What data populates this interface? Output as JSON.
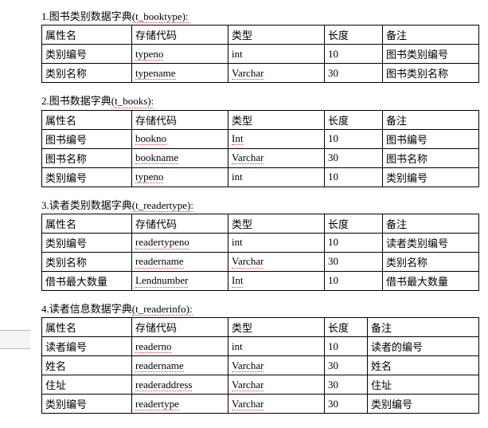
{
  "headers": [
    "属性名",
    "存储代码",
    "类型",
    "长度",
    "备注"
  ],
  "sections": [
    {
      "num": "1.",
      "title_plain": "图书类别数据字典",
      "title_spell": "(t_booktype):",
      "rows": [
        {
          "c0": "类别编号",
          "c1": "typeno",
          "c1sp": true,
          "c2": "int",
          "c2sp": false,
          "c3": "10",
          "c4": "图书类别编号"
        },
        {
          "c0": "类别名称",
          "c1": "typename",
          "c1sp": true,
          "c2": "Varchar",
          "c2sp": true,
          "c3": "30",
          "c4": "图书类别名称"
        }
      ]
    },
    {
      "num": "2.",
      "title_plain": "图书数据字典",
      "title_spell": "(t_books):",
      "rows": [
        {
          "c0": "图书编号",
          "c1": "bookno",
          "c1sp": true,
          "c2": "Int",
          "c2sp": true,
          "c3": "10",
          "c4": "图书编号"
        },
        {
          "c0": "图书名称",
          "c1": "bookname",
          "c1sp": true,
          "c2": "Varchar",
          "c2sp": true,
          "c3": "30",
          "c4": "图书名称"
        },
        {
          "c0": "类别编号",
          "c1": "typeno",
          "c1sp": true,
          "c2": "int",
          "c2sp": false,
          "c3": "10",
          "c4": "类别编号"
        }
      ]
    },
    {
      "num": "3.",
      "title_plain": "读者类别数据字典",
      "title_spell": "(t_readertype):",
      "rows": [
        {
          "c0": "类别编号",
          "c1": "readertypeno",
          "c1sp": true,
          "c2": "int",
          "c2sp": false,
          "c3": "10",
          "c4": "读者类别编号"
        },
        {
          "c0": "类别名称",
          "c1": "readername",
          "c1sp": true,
          "c2": "Varchar",
          "c2sp": true,
          "c3": "30",
          "c4": "类别名称"
        },
        {
          "c0": "借书最大数量",
          "c1": "Lendnumber",
          "c1sp": true,
          "c2": "Int",
          "c2sp": true,
          "c3": "10",
          "c4": "借书最大数量"
        }
      ]
    },
    {
      "num": "4.",
      "title_plain": "读者信息数据字典",
      "title_spell": "(t_readerinfo):",
      "rows": [
        {
          "c0": "读者编号",
          "c1": "readerno",
          "c1sp": true,
          "c2": "int",
          "c2sp": false,
          "c3": "10",
          "c4": "读者的编号"
        },
        {
          "c0": "姓名",
          "c1": "readername",
          "c1sp": true,
          "c2": "Varchar",
          "c2sp": true,
          "c3": "30",
          "c4": "姓名"
        },
        {
          "c0": "住址",
          "c1": "readeraddress",
          "c1sp": true,
          "c2": "Varchar",
          "c2sp": true,
          "c3": "30",
          "c4": "住址"
        },
        {
          "c0": "类别编号",
          "c1": "readertype",
          "c1sp": true,
          "c2": "Varchar",
          "c2sp": true,
          "c3": "30",
          "c4": "类别编号"
        }
      ]
    }
  ]
}
